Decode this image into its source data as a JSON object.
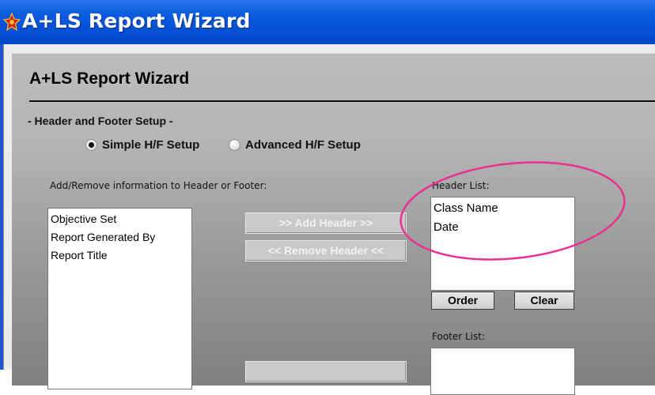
{
  "window": {
    "title": "A+LS Report Wizard"
  },
  "wizard": {
    "title": "A+LS Report Wizard",
    "section": "- Header and Footer Setup -",
    "mode": {
      "options": [
        "Simple H/F Setup",
        "Advanced H/F Setup"
      ],
      "selected": "Simple H/F Setup"
    },
    "available": {
      "label": "Add/Remove information to Header or Footer:",
      "items": [
        "Objective Set",
        "Report Generated By",
        "Report Title"
      ]
    },
    "buttons": {
      "add_header": ">> Add Header >>",
      "remove_header": "<< Remove Header <<",
      "order": "Order",
      "clear": "Clear"
    },
    "header_list": {
      "label": "Header List:",
      "items": [
        "Class Name",
        "Date"
      ]
    },
    "footer_list": {
      "label": "Footer List:",
      "items": []
    }
  },
  "colors": {
    "titlebar": "#0a5ae0",
    "annotation": "#e8318f"
  },
  "icons": {
    "app_logo": "a-plus-ls-logo-icon"
  }
}
